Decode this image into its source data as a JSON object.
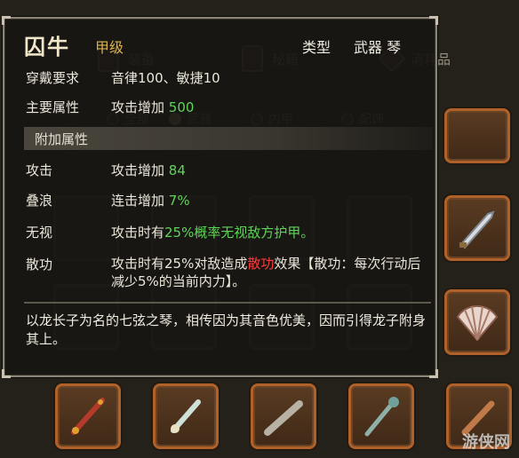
{
  "background": {
    "tabs": [
      {
        "label": "装备"
      },
      {
        "label": "秘籍"
      },
      {
        "label": "消耗品"
      }
    ],
    "filters": [
      {
        "label": "全部",
        "selected": false
      },
      {
        "label": "武器",
        "selected": true
      },
      {
        "label": "内甲",
        "selected": false
      },
      {
        "label": "配饰",
        "selected": false
      }
    ]
  },
  "tooltip": {
    "name": "囚牛",
    "grade": "甲级",
    "type_label": "类型",
    "type_value": "武器 琴",
    "requirement_label": "穿戴要求",
    "requirement_value": "音律100、敏捷10",
    "main_attr_label": "主要属性",
    "main_attr_text": "攻击增加",
    "main_attr_value": "500",
    "extra_header": "附加属性",
    "extras": [
      {
        "label": "攻击",
        "text": "攻击增加",
        "value": "84"
      },
      {
        "label": "叠浪",
        "text": "连击增加",
        "value": "7%"
      }
    ],
    "ignore": {
      "label": "无视",
      "pre": "攻击时有",
      "value": "25%",
      "post": "概率无视敌方护甲。"
    },
    "sangong": {
      "label": "散功",
      "pre": "攻击时有25%对敌造成",
      "keyword": "散功",
      "post": "效果【散功：每次行动后减少5%的当前内力】。"
    },
    "description": "以龙长子为名的七弦之琴，相传因为其音色优美，因而引得龙子附身其上。"
  },
  "watermark": "游侠网",
  "colors": {
    "grade": "#d8b24a",
    "positive": "#5fd45a",
    "keyword": "#ff3b3b",
    "slot_border": "#b0612a"
  }
}
